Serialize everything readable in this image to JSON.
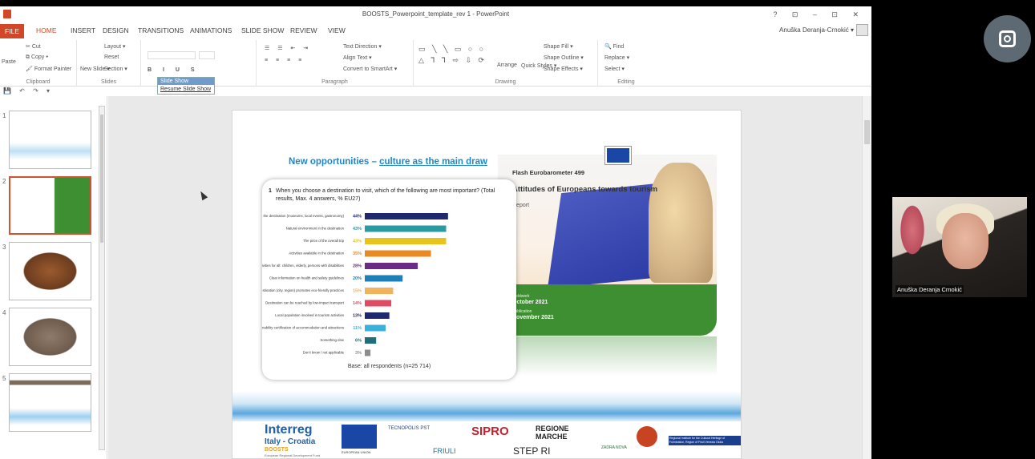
{
  "window": {
    "title": "BOOSTS_Powerpoint_template_rev 1 - PowerPoint",
    "controls": "? ⊡ – ⊡ ✕"
  },
  "ribbon_tabs": [
    "FILE",
    "HOME",
    "INSERT",
    "DESIGN",
    "TRANSITIONS",
    "ANIMATIONS",
    "SLIDE SHOW",
    "REVIEW",
    "VIEW"
  ],
  "user": "Anuška Deranja-Crnokić ▾",
  "ribbon": {
    "clipboard": {
      "cut": "Cut",
      "copy": "Copy ▾",
      "paste": "Paste",
      "format_painter": "Format Painter",
      "label": "Clipboard"
    },
    "slides": {
      "new_slide": "New Slide ▾",
      "layout": "Layout ▾",
      "reset": "Reset",
      "section": "Section ▾",
      "label": "Slides"
    },
    "paragraph": {
      "text_direction": "Text Direction ▾",
      "align_text": "Align Text ▾",
      "convert_smartart": "Convert to SmartArt ▾",
      "label": "Paragraph"
    },
    "drawing": {
      "arrange": "Arrange",
      "quick_styles": "Quick Styles ▾",
      "shape_fill": "Shape Fill ▾",
      "shape_outline": "Shape Outline ▾",
      "shape_effects": "Shape Effects ▾",
      "label": "Drawing"
    },
    "editing": {
      "find": "Find",
      "replace": "Replace ▾",
      "select": "Select ▾",
      "label": "Editing"
    }
  },
  "tooltip": {
    "title": "Slide Show",
    "body": "Resume Slide Show"
  },
  "thumbnails": [
    "1",
    "2",
    "3",
    "4",
    "5"
  ],
  "slide": {
    "title_a": "New opportunities",
    "title_sep": " – ",
    "title_b": "culture as the main draw",
    "question_num": "1",
    "question": "When you choose a destination to visit, which of the following are most important? (Total results, Max. 4 answers, % EU27)",
    "base": "Base: all respondents (n=25 714)",
    "cover": {
      "label": "Flash Eurobarometer 499",
      "title": "Attitudes of Europeans towards tourism",
      "report": "Report",
      "fieldwork_label": "Fieldwork",
      "fieldwork": "October 2021",
      "publication_label": "Publication",
      "publication": "November 2021"
    },
    "logos": {
      "interreg": "Interreg",
      "italy_croatia": "Italy - Croatia",
      "boosts": "BOOSTS",
      "erdf": "European Regional Development Fund",
      "eu": "EUROPEAN UNION",
      "tecnopolis": "TECNOPOLIS PST",
      "sipro": "SIPRO",
      "regione_marche": "REGIONE MARCHE",
      "friuli": "FRIULI",
      "step": "STEP RI",
      "zadra": "ZADRA NOVA",
      "institute": "Regional Institute for the Cultural Heritage of Fulmination, Region of Friuli Venezia Giulia"
    }
  },
  "chart_data": {
    "type": "bar",
    "orientation": "horizontal",
    "categories": [
      "Cultural offerings at the destination (museums, local events, gastronomy)",
      "Natural environment in the destination",
      "The price of the overall trip",
      "Activities available in the destination",
      "Accessibility of services and activities for all: children, elderly, persons with disabilities",
      "Clear information on health and safety guidelines",
      "Destination (city, region) promotes eco-friendly practices",
      "Destination can be reached by low-impact transport",
      "Local population involved in tourism activities",
      "Sustainability certification of accommodation and attractions",
      "Something else",
      "Don't know / not applicable"
    ],
    "values": [
      44,
      43,
      43,
      35,
      28,
      20,
      15,
      14,
      13,
      11,
      6,
      3
    ],
    "value_labels": [
      "44%",
      "43%",
      "43%",
      "35%",
      "28%",
      "20%",
      "15%",
      "14%",
      "13%",
      "11%",
      "6%",
      "3%"
    ],
    "colors": [
      "#1f2a6e",
      "#2b9aa0",
      "#e7c31c",
      "#e98a23",
      "#6a2a86",
      "#1f7fb7",
      "#f2b35c",
      "#e04a62",
      "#1f2a6e",
      "#3fb0d9",
      "#1f6f7b",
      "#8d8d8d"
    ],
    "xlim": [
      0,
      50
    ]
  },
  "webcam": {
    "name": "Anuška Deranja Crnokić"
  }
}
